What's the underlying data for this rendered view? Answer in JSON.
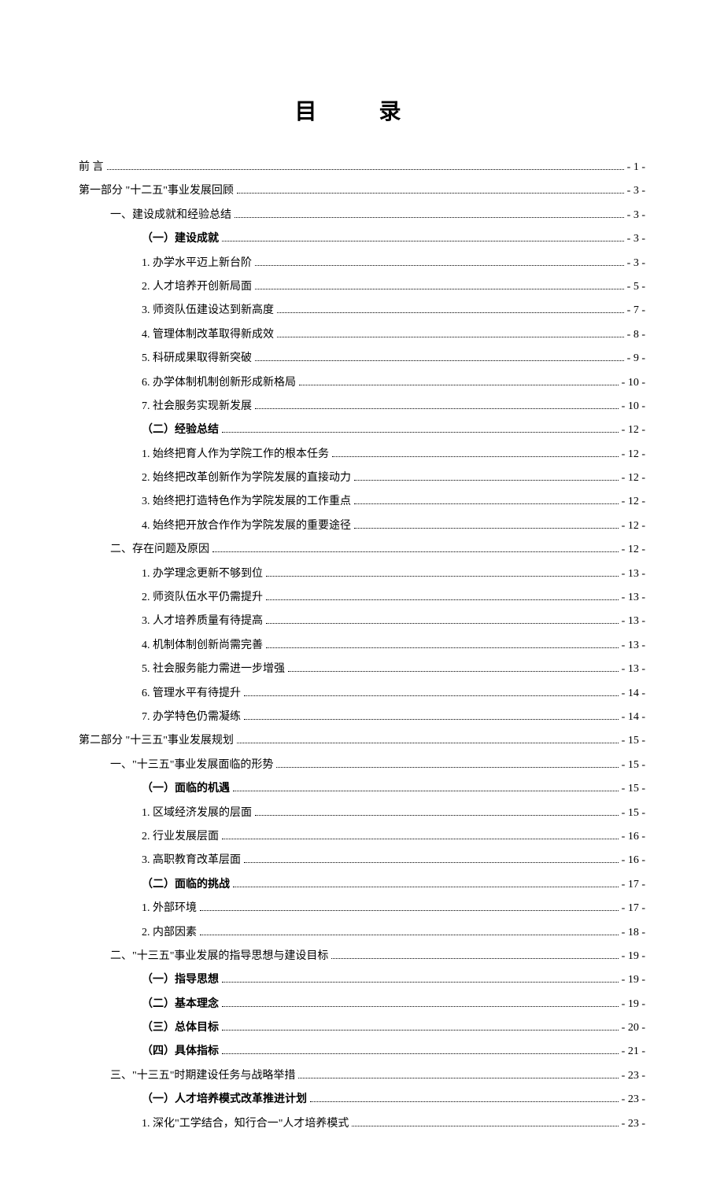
{
  "title": "目 录",
  "toc": [
    {
      "label": "前   言",
      "page": "- 1 -",
      "level": 0,
      "bold": false
    },
    {
      "label": "第一部分    \"十二五\"事业发展回顾",
      "page": "- 3 -",
      "level": 0,
      "bold": false
    },
    {
      "label": "一、建设成就和经验总结",
      "page": "- 3 -",
      "level": 1,
      "bold": false
    },
    {
      "label": "（一）建设成就",
      "page": "- 3 -",
      "level": 2,
      "bold": true
    },
    {
      "label": "1. 办学水平迈上新台阶",
      "page": "- 3 -",
      "level": 2,
      "bold": false
    },
    {
      "label": "2. 人才培养开创新局面",
      "page": "- 5 -",
      "level": 2,
      "bold": false
    },
    {
      "label": "3. 师资队伍建设达到新高度",
      "page": "- 7 -",
      "level": 2,
      "bold": false
    },
    {
      "label": "4. 管理体制改革取得新成效",
      "page": "- 8 -",
      "level": 2,
      "bold": false
    },
    {
      "label": "5. 科研成果取得新突破",
      "page": "- 9 -",
      "level": 2,
      "bold": false
    },
    {
      "label": "6. 办学体制机制创新形成新格局",
      "page": "- 10 -",
      "level": 2,
      "bold": false
    },
    {
      "label": "7. 社会服务实现新发展",
      "page": "- 10 -",
      "level": 2,
      "bold": false
    },
    {
      "label": "（二）经验总结",
      "page": "- 12 -",
      "level": 2,
      "bold": true
    },
    {
      "label": "1. 始终把育人作为学院工作的根本任务",
      "page": "- 12 -",
      "level": 2,
      "bold": false
    },
    {
      "label": "2. 始终把改革创新作为学院发展的直接动力",
      "page": "- 12 -",
      "level": 2,
      "bold": false
    },
    {
      "label": "3. 始终把打造特色作为学院发展的工作重点",
      "page": "- 12 -",
      "level": 2,
      "bold": false
    },
    {
      "label": "4. 始终把开放合作作为学院发展的重要途径",
      "page": "- 12 -",
      "level": 2,
      "bold": false
    },
    {
      "label": "二、存在问题及原因",
      "page": "- 12 -",
      "level": 1,
      "bold": false
    },
    {
      "label": "1. 办学理念更新不够到位",
      "page": "- 13 -",
      "level": 2,
      "bold": false
    },
    {
      "label": "2. 师资队伍水平仍需提升",
      "page": "- 13 -",
      "level": 2,
      "bold": false
    },
    {
      "label": "3. 人才培养质量有待提高",
      "page": "- 13 -",
      "level": 2,
      "bold": false
    },
    {
      "label": "4. 机制体制创新尚需完善",
      "page": "- 13 -",
      "level": 2,
      "bold": false
    },
    {
      "label": "5. 社会服务能力需进一步增强",
      "page": "- 13 -",
      "level": 2,
      "bold": false
    },
    {
      "label": "6. 管理水平有待提升",
      "page": "- 14 -",
      "level": 2,
      "bold": false
    },
    {
      "label": "7. 办学特色仍需凝练",
      "page": "- 14 -",
      "level": 2,
      "bold": false
    },
    {
      "label": "第二部分  \"十三五\"事业发展规划",
      "page": "- 15 -",
      "level": 0,
      "bold": false
    },
    {
      "label": "一、\"十三五\"事业发展面临的形势",
      "page": "- 15 -",
      "level": 1,
      "bold": false
    },
    {
      "label": "（一）面临的机遇",
      "page": "- 15 -",
      "level": 2,
      "bold": true
    },
    {
      "label": "1. 区域经济发展的层面",
      "page": "- 15 -",
      "level": 2,
      "bold": false
    },
    {
      "label": "2. 行业发展层面",
      "page": "- 16 -",
      "level": 2,
      "bold": false
    },
    {
      "label": "3. 高职教育改革层面",
      "page": "- 16 -",
      "level": 2,
      "bold": false
    },
    {
      "label": "（二）面临的挑战",
      "page": "- 17 -",
      "level": 2,
      "bold": true
    },
    {
      "label": "1. 外部环境",
      "page": "- 17 -",
      "level": 2,
      "bold": false
    },
    {
      "label": "2. 内部因素",
      "page": "- 18 -",
      "level": 2,
      "bold": false
    },
    {
      "label": "二、\"十三五\"事业发展的指导思想与建设目标",
      "page": "- 19 -",
      "level": 1,
      "bold": false
    },
    {
      "label": "（一）指导思想",
      "page": "- 19 -",
      "level": 2,
      "bold": true
    },
    {
      "label": "（二）基本理念",
      "page": "- 19 -",
      "level": 2,
      "bold": true
    },
    {
      "label": "（三）总体目标",
      "page": "- 20 -",
      "level": 2,
      "bold": true
    },
    {
      "label": "（四）具体指标",
      "page": "- 21 -",
      "level": 2,
      "bold": true
    },
    {
      "label": "三、\"十三五\"时期建设任务与战略举措",
      "page": "- 23 -",
      "level": 1,
      "bold": false
    },
    {
      "label": "（一）人才培养模式改革推进计划",
      "page": "- 23 -",
      "level": 2,
      "bold": true
    },
    {
      "label": "1. 深化\"工学结合，知行合一\"人才培养模式",
      "page": "- 23 -",
      "level": 2,
      "bold": false
    }
  ]
}
